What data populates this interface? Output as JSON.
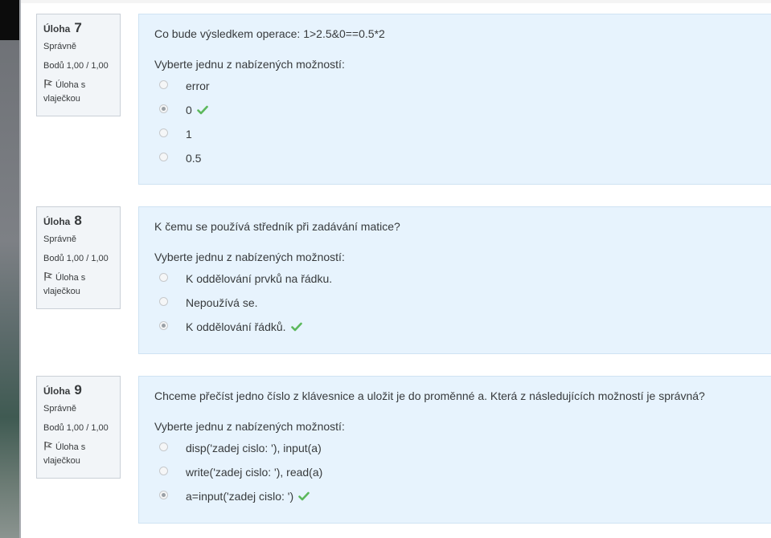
{
  "labels": {
    "question_word": "Úloha",
    "state": "Správně",
    "grade": "Bodů 1,00 / 1,00",
    "flag_text": "Úloha s vlaječkou",
    "prompt": "Vyberte jednu z nabízených možností:"
  },
  "questions": [
    {
      "number": "7",
      "text": "Co bude výsledkem operace: 1>2.5&0==0.5*2",
      "options": [
        "error",
        "0",
        "1",
        "0.5"
      ],
      "selected_index": 1
    },
    {
      "number": "8",
      "text": "K čemu se používá středník při zadávání matice?",
      "options": [
        "K oddělování prvků na řádku.",
        "Nepoužívá se.",
        "K oddělování řádků."
      ],
      "selected_index": 2
    },
    {
      "number": "9",
      "text": "Chceme přečíst jedno číslo z klávesnice a uložit je do proměnné a. Která z následujících možností je správná?",
      "options": [
        "disp('zadej cislo: '), input(a)",
        "write('zadej cislo: '), read(a)",
        "a=input('zadej cislo: ')"
      ],
      "selected_index": 2
    }
  ],
  "colors": {
    "correct_check": "#5cb85c",
    "content_bg": "#e7f3fd",
    "info_bg": "#f2f5f8"
  }
}
